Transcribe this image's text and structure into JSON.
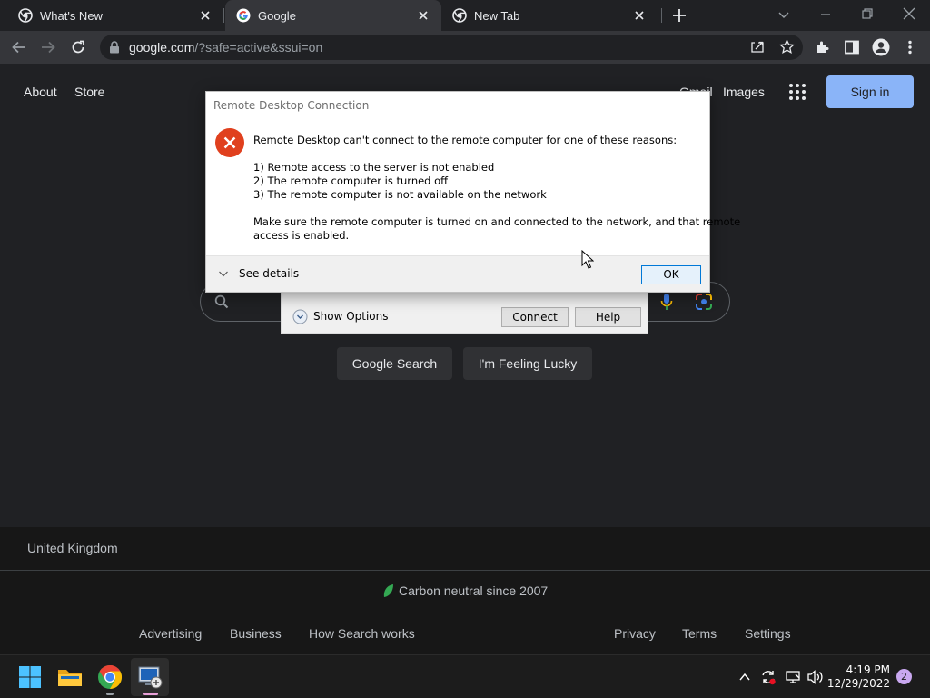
{
  "browser": {
    "tabs": [
      {
        "title": "What's New",
        "active": false
      },
      {
        "title": "Google",
        "active": true
      },
      {
        "title": "New Tab",
        "active": false
      }
    ],
    "url_host": "google.com",
    "url_rest": "/?safe=active&ssui=on"
  },
  "page": {
    "top_left_links": [
      "About",
      "Store"
    ],
    "top_right_links": [
      "Gmail",
      "Images"
    ],
    "sign_in_label": "Sign in",
    "search_buttons": [
      "Google Search",
      "I'm Feeling Lucky"
    ],
    "country": "United Kingdom",
    "carbon": "Carbon neutral since 2007",
    "footer_left": [
      "Advertising",
      "Business",
      "How Search works"
    ],
    "footer_right": [
      "Privacy",
      "Terms",
      "Settings"
    ]
  },
  "rdp_window": {
    "show_options_label": "Show Options",
    "connect_label": "Connect",
    "help_label": "Help"
  },
  "dialog": {
    "title": "Remote Desktop Connection",
    "message": "Remote Desktop can't connect to the remote computer for one of these reasons:",
    "reasons": [
      "1) Remote access to the server is not enabled",
      "2) The remote computer is turned off",
      "3) The remote computer is not available on the network"
    ],
    "advice_line1": "Make sure the remote computer is turned on and connected to the network, and that remote",
    "advice_line2": "access is enabled.",
    "see_details_label": "See details",
    "ok_label": "OK"
  },
  "taskbar": {
    "time": "4:19 PM",
    "date": "12/29/2022",
    "notification_count": "2"
  },
  "colors": {
    "accent_blue": "#8ab4f8",
    "error_red": "#e0401e",
    "page_bg": "#202124"
  }
}
